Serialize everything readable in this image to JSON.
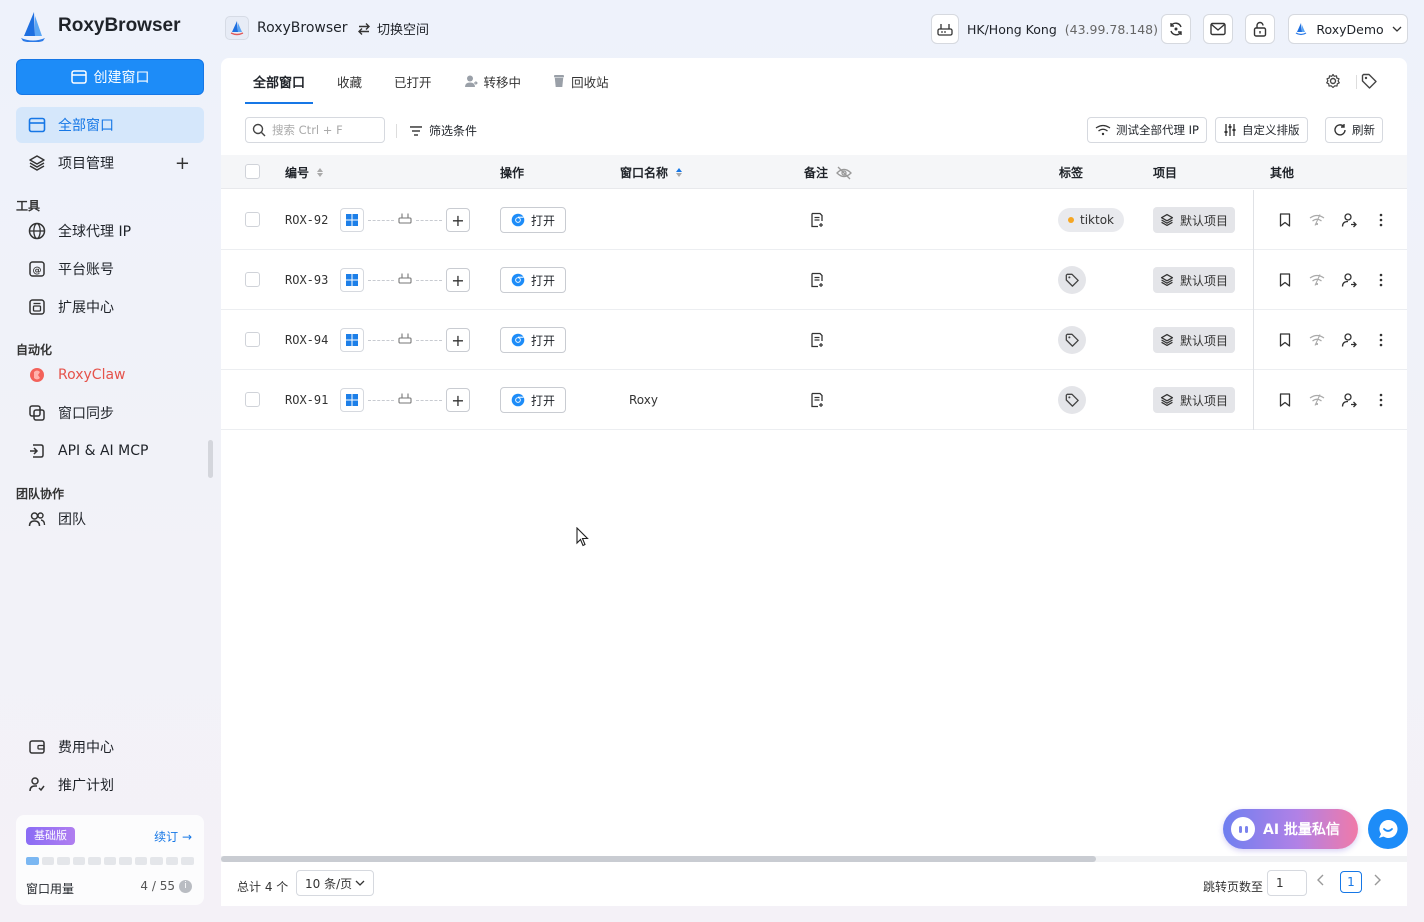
{
  "app": {
    "name": "RoxyBrowser"
  },
  "sidebar": {
    "create_label": "创建窗口",
    "items": [
      {
        "label": "全部窗口",
        "icon": "window-icon",
        "active": true
      },
      {
        "label": "项目管理",
        "icon": "layers-icon"
      }
    ],
    "tools_title": "工具",
    "tools": [
      {
        "label": "全球代理 IP",
        "icon": "globe-icon"
      },
      {
        "label": "平台账号",
        "icon": "account-icon"
      },
      {
        "label": "扩展中心",
        "icon": "extension-icon"
      }
    ],
    "automation_title": "自动化",
    "automation": [
      {
        "label": "RoxyClaw",
        "icon": "claw-icon"
      },
      {
        "label": "窗口同步",
        "icon": "sync-windows-icon"
      },
      {
        "label": "API & AI MCP",
        "icon": "api-icon"
      }
    ],
    "team_title": "团队协作",
    "team": [
      {
        "label": "团队",
        "icon": "team-icon"
      }
    ],
    "bottom": [
      {
        "label": "费用中心",
        "icon": "wallet-icon"
      },
      {
        "label": "推广计划",
        "icon": "promote-icon"
      }
    ],
    "plan": {
      "badge": "基础版",
      "renew": "续订 →",
      "usage_label": "窗口用量",
      "usage_count": "4 / 55",
      "usage_fraction": 0.0727,
      "info": "i"
    }
  },
  "topbar": {
    "brand": "RoxyBrowser",
    "switch_space": "切换空间",
    "proxy_location": "HK/Hong Kong",
    "proxy_ip": "(43.99.78.148)",
    "user": "RoxyDemo"
  },
  "tabs": [
    {
      "label": "全部窗口",
      "active": true
    },
    {
      "label": "收藏"
    },
    {
      "label": "已打开"
    },
    {
      "label": "转移中",
      "icon": "transfer-user-icon"
    },
    {
      "label": "回收站",
      "icon": "trash-icon"
    }
  ],
  "toolbar": {
    "search_placeholder": "搜索 Ctrl + F",
    "filter": "筛选条件",
    "test_proxy": "测试全部代理 IP",
    "custom_sort": "自定义排版",
    "refresh": "刷新"
  },
  "table": {
    "headers": {
      "code": "编号",
      "action": "操作",
      "name": "窗口名称",
      "note": "备注",
      "tag": "标签",
      "project": "项目",
      "other": "其他"
    },
    "rows": [
      {
        "code": "ROX-92",
        "open": "打开",
        "name": "",
        "tag": "tiktok",
        "project": "默认项目"
      },
      {
        "code": "ROX-93",
        "open": "打开",
        "name": "",
        "tag": "",
        "project": "默认项目"
      },
      {
        "code": "ROX-94",
        "open": "打开",
        "name": "",
        "tag": "",
        "project": "默认项目"
      },
      {
        "code": "ROX-91",
        "open": "打开",
        "name": "Roxy",
        "tag": "",
        "project": "默认项目"
      }
    ]
  },
  "footer": {
    "total": "总计 4 个",
    "page_size": "10 条/页",
    "jump_label": "跳转页数至",
    "jump_value": "1",
    "current_page": "1"
  },
  "floating": {
    "ai_label": "AI 批量私信"
  },
  "colors": {
    "accent": "#1d8cf8",
    "active_bg": "#d5e7fb"
  }
}
